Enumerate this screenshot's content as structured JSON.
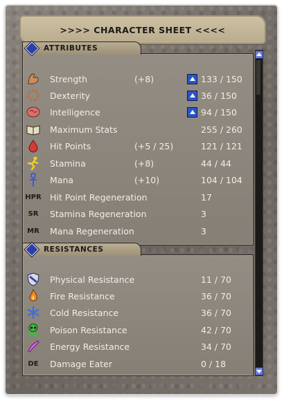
{
  "window": {
    "title": ">>>> CHARACTER SHEET <<<<"
  },
  "attributes": {
    "header": "ATTRIBUTES",
    "rows": [
      {
        "icon": "strength-arm-icon",
        "label": "Strength",
        "bonus": "(+8)",
        "lockable": true,
        "value": "133 / 150"
      },
      {
        "icon": "dexterity-ring-icon",
        "label": "Dexterity",
        "bonus": "",
        "lockable": true,
        "value": "36 / 150"
      },
      {
        "icon": "brain-icon",
        "label": "Intelligence",
        "bonus": "",
        "lockable": true,
        "value": "94 / 150"
      },
      {
        "icon": "open-book-icon",
        "label": "Maximum Stats",
        "bonus": "",
        "lockable": false,
        "value": "255 / 260"
      },
      {
        "icon": "blood-drop-icon",
        "label": "Hit Points",
        "bonus": "(+5 / 25)",
        "lockable": false,
        "value": "121 / 121"
      },
      {
        "icon": "running-man-icon",
        "label": "Stamina",
        "bonus": "(+8)",
        "lockable": false,
        "value": "44 / 44"
      },
      {
        "icon": "ankh-icon",
        "label": "Mana",
        "bonus": "(+10)",
        "lockable": false,
        "value": "104 / 104"
      },
      {
        "icon": "HPR",
        "label": "Hit Point Regeneration",
        "bonus": "",
        "lockable": false,
        "value": "17"
      },
      {
        "icon": "SR",
        "label": "Stamina Regeneration",
        "bonus": "",
        "lockable": false,
        "value": "3"
      },
      {
        "icon": "MR",
        "label": "Mana Regeneration",
        "bonus": "",
        "lockable": false,
        "value": "3"
      }
    ]
  },
  "resistances": {
    "header": "RESISTANCES",
    "rows": [
      {
        "icon": "shield-icon",
        "label": "Physical Resistance",
        "value": "11 / 70"
      },
      {
        "icon": "flame-icon",
        "label": "Fire Resistance",
        "value": "36 / 70"
      },
      {
        "icon": "snowflake-icon",
        "label": "Cold Resistance",
        "value": "36 / 70"
      },
      {
        "icon": "skull-icon",
        "label": "Poison Resistance",
        "value": "42 / 70"
      },
      {
        "icon": "energy-bolt-icon",
        "label": "Energy Resistance",
        "value": "34 / 70"
      },
      {
        "icon": "DE",
        "label": "Damage Eater",
        "value": "0 / 18"
      }
    ]
  },
  "colors": {
    "text": "#f2efe6",
    "panel": "#8d877e",
    "accent": "#2a55c8"
  }
}
